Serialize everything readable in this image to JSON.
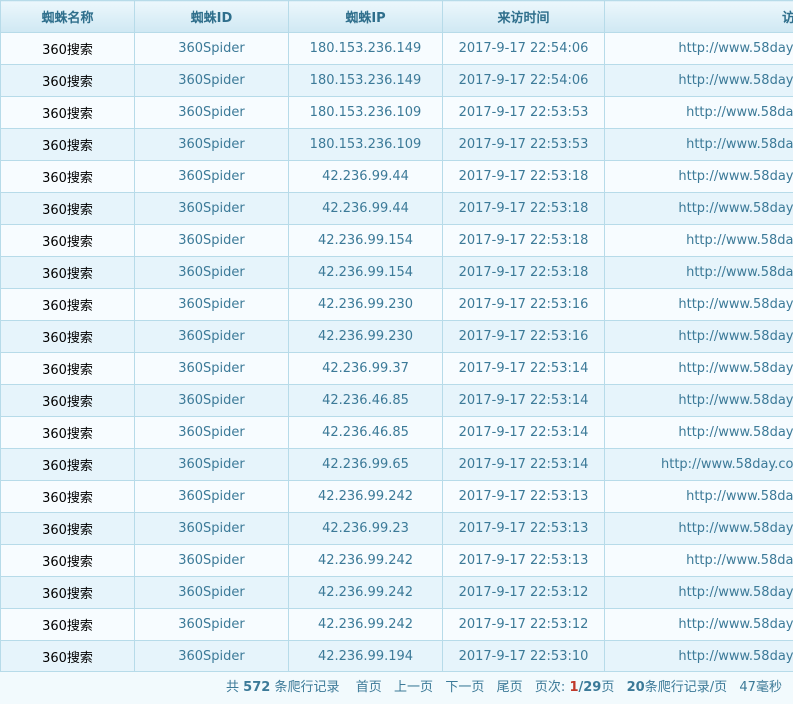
{
  "columns": [
    "蜘蛛名称",
    "蜘蛛ID",
    "蜘蛛IP",
    "来访时间",
    "访"
  ],
  "rows": [
    {
      "name": "360搜索",
      "id": "360Spider",
      "ip": "180.153.236.149",
      "time": "2017-9-17 22:54:06",
      "url": "http://www.58day"
    },
    {
      "name": "360搜索",
      "id": "360Spider",
      "ip": "180.153.236.149",
      "time": "2017-9-17 22:54:06",
      "url": "http://www.58day"
    },
    {
      "name": "360搜索",
      "id": "360Spider",
      "ip": "180.153.236.109",
      "time": "2017-9-17 22:53:53",
      "url": "http://www.58da"
    },
    {
      "name": "360搜索",
      "id": "360Spider",
      "ip": "180.153.236.109",
      "time": "2017-9-17 22:53:53",
      "url": "http://www.58da"
    },
    {
      "name": "360搜索",
      "id": "360Spider",
      "ip": "42.236.99.44",
      "time": "2017-9-17 22:53:18",
      "url": "http://www.58day"
    },
    {
      "name": "360搜索",
      "id": "360Spider",
      "ip": "42.236.99.44",
      "time": "2017-9-17 22:53:18",
      "url": "http://www.58day"
    },
    {
      "name": "360搜索",
      "id": "360Spider",
      "ip": "42.236.99.154",
      "time": "2017-9-17 22:53:18",
      "url": "http://www.58da"
    },
    {
      "name": "360搜索",
      "id": "360Spider",
      "ip": "42.236.99.154",
      "time": "2017-9-17 22:53:18",
      "url": "http://www.58da"
    },
    {
      "name": "360搜索",
      "id": "360Spider",
      "ip": "42.236.99.230",
      "time": "2017-9-17 22:53:16",
      "url": "http://www.58day"
    },
    {
      "name": "360搜索",
      "id": "360Spider",
      "ip": "42.236.99.230",
      "time": "2017-9-17 22:53:16",
      "url": "http://www.58day"
    },
    {
      "name": "360搜索",
      "id": "360Spider",
      "ip": "42.236.99.37",
      "time": "2017-9-17 22:53:14",
      "url": "http://www.58day"
    },
    {
      "name": "360搜索",
      "id": "360Spider",
      "ip": "42.236.46.85",
      "time": "2017-9-17 22:53:14",
      "url": "http://www.58day"
    },
    {
      "name": "360搜索",
      "id": "360Spider",
      "ip": "42.236.46.85",
      "time": "2017-9-17 22:53:14",
      "url": "http://www.58day"
    },
    {
      "name": "360搜索",
      "id": "360Spider",
      "ip": "42.236.99.65",
      "time": "2017-9-17 22:53:14",
      "url": "http://www.58day.co"
    },
    {
      "name": "360搜索",
      "id": "360Spider",
      "ip": "42.236.99.242",
      "time": "2017-9-17 22:53:13",
      "url": "http://www.58da"
    },
    {
      "name": "360搜索",
      "id": "360Spider",
      "ip": "42.236.99.23",
      "time": "2017-9-17 22:53:13",
      "url": "http://www.58day"
    },
    {
      "name": "360搜索",
      "id": "360Spider",
      "ip": "42.236.99.242",
      "time": "2017-9-17 22:53:13",
      "url": "http://www.58da"
    },
    {
      "name": "360搜索",
      "id": "360Spider",
      "ip": "42.236.99.242",
      "time": "2017-9-17 22:53:12",
      "url": "http://www.58day"
    },
    {
      "name": "360搜索",
      "id": "360Spider",
      "ip": "42.236.99.242",
      "time": "2017-9-17 22:53:12",
      "url": "http://www.58day"
    },
    {
      "name": "360搜索",
      "id": "360Spider",
      "ip": "42.236.99.194",
      "time": "2017-9-17 22:53:10",
      "url": "http://www.58day"
    }
  ],
  "pager": {
    "total_prefix": "共",
    "total": "572",
    "total_suffix": "条爬行记录",
    "first": "首页",
    "prev": "上一页",
    "next": "下一页",
    "last": "尾页",
    "page_label": "页次:",
    "current_page": "1",
    "total_pages": "/29",
    "page_suffix": "页",
    "per_page": "20",
    "per_page_suffix": "条爬行记录/页",
    "elapsed": "47毫秒"
  }
}
